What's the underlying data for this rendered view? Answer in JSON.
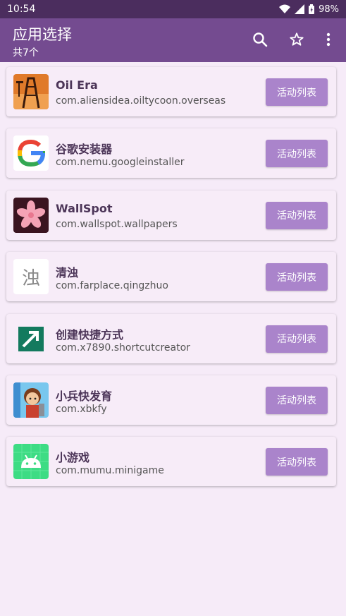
{
  "status": {
    "time": "10:54",
    "battery": "98%"
  },
  "header": {
    "title": "应用选择",
    "subtitle": "共7个",
    "actions": [
      "search-icon",
      "star-icon",
      "more-vert-icon"
    ]
  },
  "apps": [
    {
      "name": "Oil Era",
      "package": "com.aliensidea.oiltycoon.overseas",
      "button": "活动列表",
      "icon": "oil-derrick-icon"
    },
    {
      "name": "谷歌安装器",
      "package": "com.nemu.googleinstaller",
      "button": "活动列表",
      "icon": "google-g-icon"
    },
    {
      "name": "WallSpot",
      "package": "com.wallspot.wallpapers",
      "button": "活动列表",
      "icon": "flower-icon"
    },
    {
      "name": "清浊",
      "package": "com.farplace.qingzhuo",
      "button": "活动列表",
      "icon": "qingzhuo-char-icon",
      "icon_text": "浊"
    },
    {
      "name": "创建快捷方式",
      "package": "com.x7890.shortcutcreator",
      "button": "活动列表",
      "icon": "shortcut-arrow-icon"
    },
    {
      "name": "小兵快发育",
      "package": "com.xbkfy",
      "button": "活动列表",
      "icon": "soldier-character-icon"
    },
    {
      "name": "小游戏",
      "package": "com.mumu.minigame",
      "button": "活动列表",
      "icon": "android-robot-icon"
    }
  ],
  "colors": {
    "status_bar": "#4b2d5e",
    "app_bar": "#744b90",
    "background": "#f6ebf8",
    "button": "#aa84cb"
  }
}
